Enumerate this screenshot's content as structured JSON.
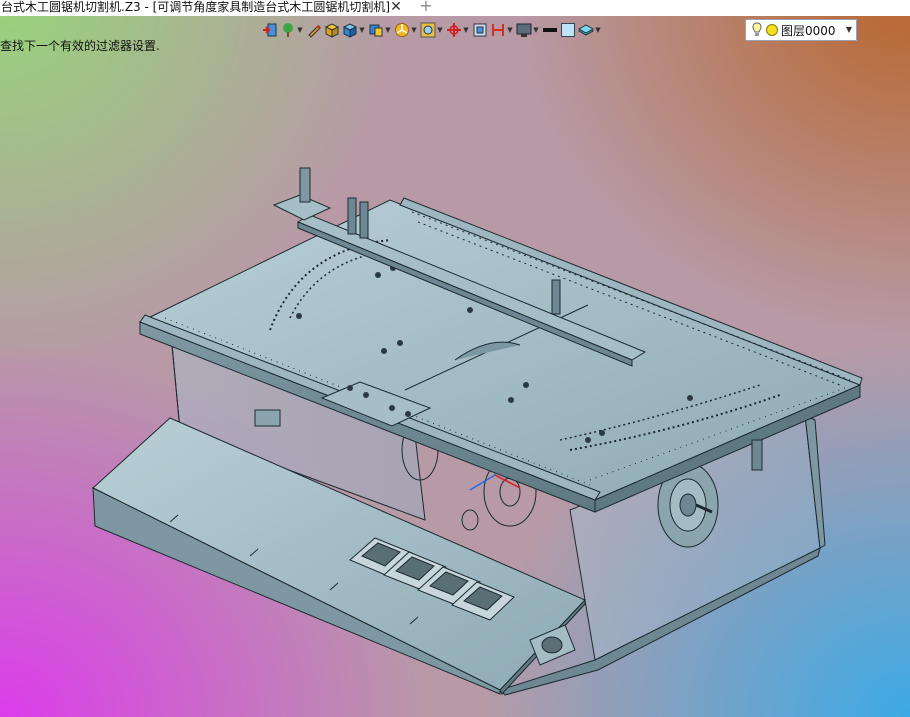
{
  "window": {
    "tab_title": "台式木工圆锯机切割机.Z3 - [可调节角度家具制造台式木工圆锯机切割机]",
    "close_glyph": "✕",
    "add_glyph": "+"
  },
  "status": {
    "message": "查找下一个有效的过滤器设置."
  },
  "toolbar": {
    "icons": [
      "import-icon",
      "tree-icon",
      "pencil-icon",
      "box-icon",
      "cube-icon",
      "view-cube-icon",
      "render-icon",
      "zoom-icon",
      "axis-icon",
      "fit-icon",
      "section-icon",
      "display-icon",
      "line-color-icon",
      "fill-color-icon",
      "layer-style-icon"
    ],
    "layer": {
      "name": "图层0000",
      "bulb_icon": "lightbulb-icon",
      "state_icon": "yellow-dot-icon"
    }
  },
  "colors": {
    "model_face": "#7fa3b0",
    "model_edge": "#1c2a30",
    "accent_red": "#d02020"
  }
}
